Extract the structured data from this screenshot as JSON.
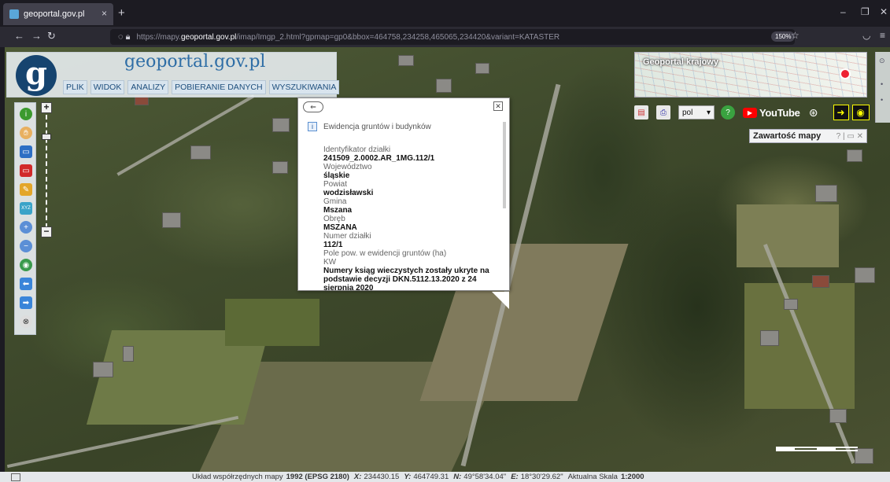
{
  "browser": {
    "tab_title": "geoportal.gov.pl",
    "tab_close": "×",
    "new_tab": "+",
    "url_prefix": "https://mapy.",
    "url_domain": "geoportal.gov.pl",
    "url_rest": "/imap/Imgp_2.html?gpmap=gp0&bbox=464758,234258,465065,234420&variant=KATASTER",
    "zoom": "150%"
  },
  "header": {
    "logo_letter": "g",
    "site_title": "geoportal.gov.pl",
    "menu": [
      "PLIK",
      "WIDOK",
      "ANALIZY",
      "POBIERANIE DANYCH",
      "WYSZUKIWANIA"
    ]
  },
  "overview": {
    "title": "Geoportal krajowy"
  },
  "toolbar_right": {
    "language": "pol",
    "youtube": "YouTube"
  },
  "map_contents_panel": {
    "title": "Zawartość mapy",
    "controls": "? | ▭ ✕"
  },
  "popup": {
    "collapse_glyph": "⇐",
    "close_glyph": "✕",
    "heading": "Ewidencja gruntów i budynków",
    "fields": [
      {
        "label": "Identyfikator działki",
        "value": "241509_2.0002.AR_1MG.112/1"
      },
      {
        "label": "Województwo",
        "value": "śląskie"
      },
      {
        "label": "Powiat",
        "value": "wodzisławski"
      },
      {
        "label": "Gmina",
        "value": "Mszana"
      },
      {
        "label": "Obręb",
        "value": "MSZANA"
      },
      {
        "label": "Numer działki",
        "value": "112/1"
      },
      {
        "label": "Pole pow. w ewidencji gruntów (ha)",
        "value": ""
      },
      {
        "label": "KW",
        "value": "Numery ksiąg wieczystych zostały ukryte na podstawie decyzji DKN.5112.13.2020 z 24 sierpnia 2020"
      }
    ]
  },
  "statusbar": {
    "system_label": "Układ współrzędnych mapy",
    "system_value": "1992 (EPSG 2180)",
    "x_label": "X:",
    "x_value": "234430.15",
    "y_label": "Y:",
    "y_value": "464749.31",
    "n_label": "N:",
    "n_value": "49°58'34.04\"",
    "e_label": "E:",
    "e_value": "18°30'29.62\"",
    "scale_label": "Aktualna Skala",
    "scale_value": "1:2000"
  },
  "colors": {
    "brand_blue": "#2f6ea6",
    "logo_navy": "#16446f",
    "browser_bg": "#1c1b22"
  }
}
